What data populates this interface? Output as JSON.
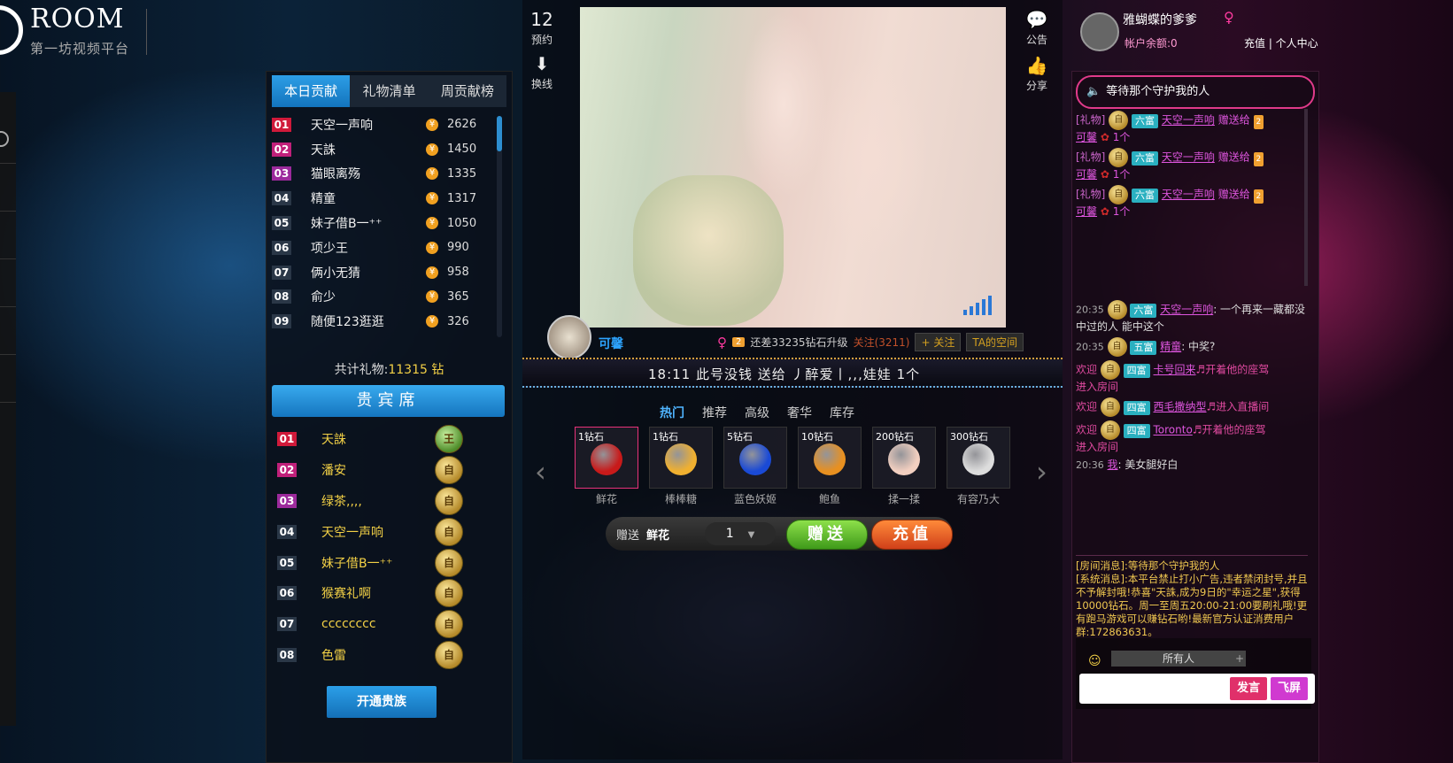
{
  "header": {
    "logo_text": "ROOM",
    "logo_sub": "第一坊视频平台"
  },
  "ranking": {
    "tabs": [
      "本日贡献",
      "礼物清单",
      "周贡献榜"
    ],
    "rows": [
      {
        "num": "01",
        "name": "天空一声响",
        "value": "2626"
      },
      {
        "num": "02",
        "name": "天誅",
        "value": "1450"
      },
      {
        "num": "03",
        "name": "猫眼离殇",
        "value": "1335"
      },
      {
        "num": "04",
        "name": "精童",
        "value": "1317"
      },
      {
        "num": "05",
        "name": "妹子借B一⁺⁺",
        "value": "1050"
      },
      {
        "num": "06",
        "name": "项少王",
        "value": "990"
      },
      {
        "num": "07",
        "name": "俩小无猜",
        "value": "958"
      },
      {
        "num": "08",
        "name": "俞少",
        "value": "365"
      },
      {
        "num": "09",
        "name": "随便123逛逛",
        "value": "326"
      }
    ],
    "total_label": "共计礼物:",
    "total_value": "11315 钻"
  },
  "vip": {
    "title": "贵宾席",
    "rows": [
      {
        "num": "01",
        "name": "天誅",
        "badge": "王"
      },
      {
        "num": "02",
        "name": "潘安",
        "badge": "自"
      },
      {
        "num": "03",
        "name": "绿茶,,,,",
        "badge": "自"
      },
      {
        "num": "04",
        "name": "天空一声响",
        "badge": "自"
      },
      {
        "num": "05",
        "name": "妹子借B一⁺⁺",
        "badge": "自"
      },
      {
        "num": "06",
        "name": "猴赛礼啊",
        "badge": "自"
      },
      {
        "num": "07",
        "name": "cccccccc",
        "badge": "自"
      },
      {
        "num": "08",
        "name": "色雷",
        "badge": "自"
      }
    ],
    "open_button": "开通贵族"
  },
  "center": {
    "side_left": [
      {
        "label": "预约"
      },
      {
        "label": "换线"
      }
    ],
    "side_left_glyphs": [
      "12",
      "⬇"
    ],
    "side_right": [
      {
        "label": "公告"
      },
      {
        "label": "分享"
      }
    ],
    "side_right_glyphs": [
      "💬",
      "👍"
    ],
    "anchor": {
      "name": "可馨",
      "level": "2",
      "upgrade": "还差33235钻石升级",
      "follow_count": "关注(3211)",
      "follow_button": "+ 关注",
      "space_button": "TA的空间"
    },
    "marquee": "18:11  此号没钱 送给 丿醉爱丨,,,娃娃    1个",
    "gift_tabs": [
      "热门",
      "推荐",
      "高级",
      "奢华",
      "库存"
    ],
    "gifts": [
      {
        "price": "1钻石",
        "name": "鲜花",
        "color": "#c81a1a"
      },
      {
        "price": "1钻石",
        "name": "棒棒糖",
        "color": "#f0b030"
      },
      {
        "price": "5钻石",
        "name": "蓝色妖姬",
        "color": "#1a4ad6"
      },
      {
        "price": "10钻石",
        "name": "鲍鱼",
        "color": "#e89020"
      },
      {
        "price": "200钻石",
        "name": "揉一揉",
        "color": "#f2cfc0"
      },
      {
        "price": "300钻石",
        "name": "有容乃大",
        "color": "#dddddd"
      }
    ],
    "send": {
      "label": "赠送",
      "gift": "鲜花",
      "qty": "1",
      "give_btn": "赠送",
      "recharge_btn": "充值"
    }
  },
  "user": {
    "name": "雅蝴蝶的爹爹",
    "balance": "帐户余额:0",
    "links": "充值 | 个人中心"
  },
  "chat": {
    "guard": "等待那个守护我的人",
    "gift_msgs": [
      {
        "tag": "[礼物]",
        "rich": "六富",
        "user": "天空一声响",
        "action": "赠送给",
        "lvl": "2",
        "to": "可馨",
        "count": "1个"
      },
      {
        "tag": "[礼物]",
        "rich": "六富",
        "user": "天空一声响",
        "action": "赠送给",
        "lvl": "2",
        "to": "可馨",
        "count": "1个"
      },
      {
        "tag": "[礼物]",
        "rich": "六富",
        "user": "天空一声响",
        "action": "赠送给",
        "lvl": "2",
        "to": "可馨",
        "count": "1个"
      }
    ],
    "main_msgs": [
      {
        "time": "20:35",
        "rich": "六富",
        "user": "天空一声响",
        "text": ": 一个再来一藏都没中过的人 能中这个"
      },
      {
        "time": "20:35",
        "rich": "五富",
        "user": "精童",
        "text": ": 中奖?"
      },
      {
        "prefix": "欢迎",
        "rich": "四富",
        "user": "卡号回来",
        "text": "♬开着他的座驾",
        "sub": "进入房间"
      },
      {
        "prefix": "欢迎",
        "rich": "四富",
        "user": "西毛撒纳型",
        "text": "♬进入直播间"
      },
      {
        "prefix": "欢迎",
        "rich": "四富",
        "user": "Toronto",
        "text": "♬开着他的座驾",
        "sub": "进入房间"
      },
      {
        "time": "20:36",
        "user": "我",
        "text": ": 美女腿好白"
      }
    ],
    "system": "[房间消息]:等待那个守护我的人\n[系统消息]:本平台禁止打小广告,违者禁闭封号,并且不予解封哦!恭喜\"天誅,成为9日的\"幸运之星\",获得10000钻石。周一至周五20:00-21:00要刷礼哦!更有跑马游戏可以赚钻石哟!最新官方认证消费用户群:172863631。",
    "recipient": "所有人",
    "say_btn": "发言",
    "fly_btn": "飞屏"
  }
}
